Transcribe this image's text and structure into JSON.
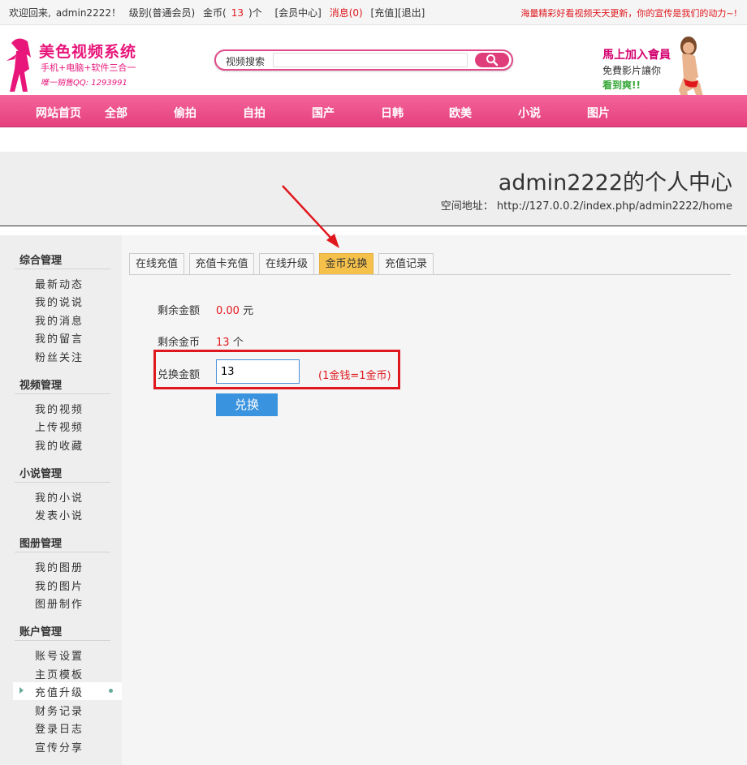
{
  "topbar": {
    "welcome": "欢迎回来,",
    "username": "admin2222！",
    "level": "级别(普通会员)",
    "coins_prefix": "金币(",
    "coins_value": "13",
    "coins_suffix": ")个",
    "member_center": "[会员中心]",
    "messages": "消息(0)",
    "recharge": "[充值]",
    "logout": "[退出]",
    "slogan": "海量精彩好看视频天天更新，你的宣传是我们的动力~!"
  },
  "logo": {
    "title": "美色视频系统",
    "subtitle": "手机+电脑+软件三合一",
    "qq": "唯一销售QQ: 1293991"
  },
  "search": {
    "label": "视频搜索",
    "placeholder": ""
  },
  "promo": {
    "line1": "馬上加入會員",
    "line2": "免費影片讓你",
    "line3": "看到爽!!"
  },
  "nav": {
    "items": [
      "网站首页",
      "全部",
      "偷拍",
      "自拍",
      "国产",
      "日韩",
      "欧美",
      "小说",
      "图片"
    ]
  },
  "profile": {
    "title": "admin2222的个人中心",
    "address_label": "空间地址：",
    "address_url": "http://127.0.0.2/index.php/admin2222/home"
  },
  "sidebar": {
    "groups": [
      {
        "title": "综合管理",
        "items": [
          "最新动态",
          "我的说说",
          "我的消息",
          "我的留言",
          "粉丝关注"
        ]
      },
      {
        "title": "视频管理",
        "items": [
          "我的视频",
          "上传视频",
          "我的收藏"
        ]
      },
      {
        "title": "小说管理",
        "items": [
          "我的小说",
          "发表小说"
        ]
      },
      {
        "title": "图册管理",
        "items": [
          "我的图册",
          "我的图片",
          "图册制作"
        ]
      },
      {
        "title": "账户管理",
        "items": [
          "账号设置",
          "主页模板",
          "充值升级",
          "财务记录",
          "登录日志",
          "宣传分享"
        ]
      }
    ]
  },
  "tabs": [
    "在线充值",
    "充值卡充值",
    "在线升级",
    "金币兑换",
    "充值记录"
  ],
  "form": {
    "balance_label": "剩余金额",
    "balance_value": "0.00",
    "balance_unit": "元",
    "coins_label": "剩余金币",
    "coins_value": "13",
    "coins_unit": "个",
    "exchange_label": "兑换金额",
    "exchange_value": "13",
    "exchange_hint": "(1金钱=1金币)",
    "submit_label": "兑换"
  },
  "colors": {
    "brand_pink": "#e8157a",
    "nav_pink": "#f0578f",
    "accent_red": "#e0181e",
    "active_tab": "#f6c14a",
    "submit_blue": "#3a93de"
  }
}
